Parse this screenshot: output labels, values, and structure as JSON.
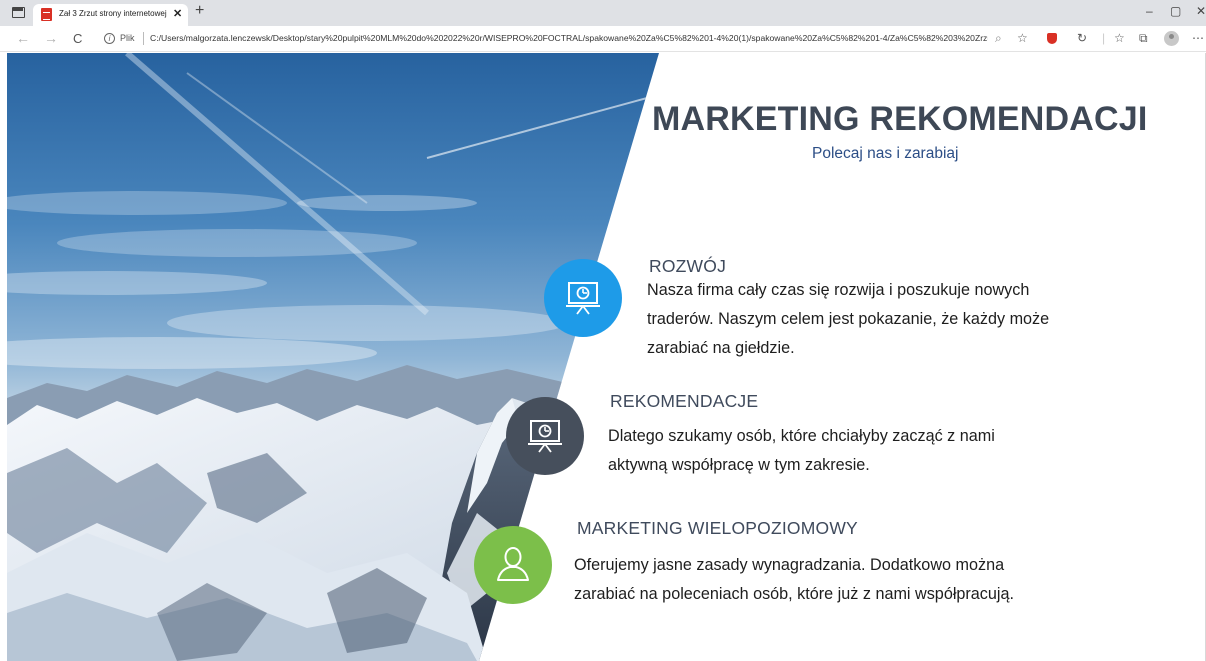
{
  "browser": {
    "tab_title": "Zał 3 Zrzut strony internetowej",
    "tab_close": "✕",
    "new_tab": "+",
    "window_controls": [
      "–",
      "▢",
      "✕"
    ],
    "nav": {
      "back": "←",
      "forward": "→",
      "reload": "C"
    },
    "info_glyph": "i",
    "protocol_label": "Plik",
    "url": "C:/Users/malgorzata.lenczewsk/Desktop/stary%20pulpit%20MLM%20do%202022%20r/WISEPRO%20FOCTRAL/spakowane%20Za%C5%82%201-4%20(1)/spakowane%20Za%C5%82%201-4/Za%C5%82%203%20Zrzut%20strony%20internet...",
    "toolbar_icons": [
      "zoom-icon",
      "favorite-add-icon",
      "shield-extension-icon",
      "refresh-extension-icon",
      "favorites-icon",
      "collections-icon",
      "profile-avatar",
      "more-icon"
    ]
  },
  "page": {
    "title": "MARKETING REKOMENDACJI",
    "subtitle": "Polecaj nas i zarabiaj",
    "features": [
      {
        "heading": "ROZWÓJ",
        "text": "Nasza firma cały czas się rozwija i poszukuje nowych traderów. Naszym celem jest pokazanie, że każdy może zarabiać na giełdzie.",
        "icon": "presentation-icon",
        "color": "#1e9be8"
      },
      {
        "heading": "REKOMENDACJE",
        "text": "Dlatego szukamy osób, które chciałyby zacząć z nami aktywną współpracę w tym zakresie.",
        "icon": "presentation-icon",
        "color": "#464f5c"
      },
      {
        "heading": "MARKETING WIELOPOZIOMOWY",
        "text": "Oferujemy jasne zasady wynagradzania. Dodatkowo można zarabiać na poleceniach osób, które już z nami współpracują.",
        "icon": "user-icon",
        "color": "#7cbf4a"
      }
    ]
  }
}
